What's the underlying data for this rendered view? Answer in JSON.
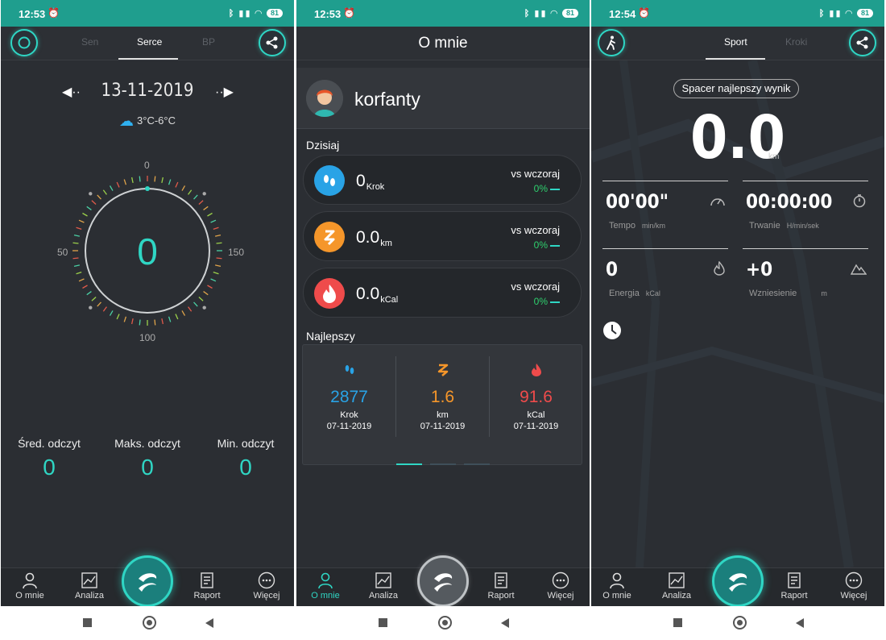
{
  "screens": [
    {
      "status": {
        "time": "12:53",
        "battery": "81"
      },
      "tabs": [
        "Sen",
        "Serce",
        "BP"
      ],
      "date": "13-11-2019",
      "weather": "3°C-6°C",
      "gauge": {
        "value": "0",
        "top": "0",
        "left": "50",
        "right": "150",
        "bottom": "100"
      },
      "stats": [
        {
          "label": "Śred. odczyt",
          "value": "0"
        },
        {
          "label": "Maks. odczyt",
          "value": "0"
        },
        {
          "label": "Min. odczyt",
          "value": "0"
        }
      ]
    },
    {
      "status": {
        "time": "12:53",
        "battery": "81"
      },
      "title": "O mnie",
      "username": "korfanty",
      "today_label": "Dzisiaj",
      "cards": [
        {
          "value": "0",
          "unit": "Krok",
          "vs": "vs wczoraj",
          "pct": "0%",
          "color": "#29a3e6"
        },
        {
          "value": "0.0",
          "unit": "km",
          "vs": "vs wczoraj",
          "pct": "0%",
          "color": "#f5962a"
        },
        {
          "value": "0.0",
          "unit": "kCal",
          "vs": "vs wczoraj",
          "pct": "0%",
          "color": "#ef4b4b"
        }
      ],
      "best_label": "Najlepszy",
      "best": [
        {
          "value": "2877",
          "unit": "Krok",
          "date": "07-11-2019",
          "color": "#29a3e6"
        },
        {
          "value": "1.6",
          "unit": "km",
          "date": "07-11-2019",
          "color": "#f5962a"
        },
        {
          "value": "91.6",
          "unit": "kCal",
          "date": "07-11-2019",
          "color": "#ef4b4b"
        }
      ]
    },
    {
      "status": {
        "time": "12:54",
        "battery": "81"
      },
      "tabs": [
        "Sport",
        "Kroki"
      ],
      "best_pill": "Spacer najlepszy wynik",
      "distance": "0.0",
      "distance_unit": "km",
      "metrics": [
        {
          "value": "00'00\"",
          "label": "Tempo",
          "unit": "min/km",
          "icon": "speedometer-icon"
        },
        {
          "value": "00:00:00",
          "label": "Trwanie",
          "unit": "H/min/sek",
          "icon": "stopwatch-icon"
        },
        {
          "value": "0",
          "label": "Energia",
          "unit": "kCal",
          "icon": "flame-icon"
        },
        {
          "value": "+0",
          "label": "Wzniesienie",
          "unit": "m",
          "icon": "mountain-icon"
        }
      ]
    }
  ],
  "bottom_nav": [
    "O mnie",
    "Analiza",
    "Raport",
    "Więcej"
  ],
  "colors": {
    "accent": "#2fd6c4",
    "statusbar": "#1f9e8e",
    "bg": "#2b2e33"
  }
}
